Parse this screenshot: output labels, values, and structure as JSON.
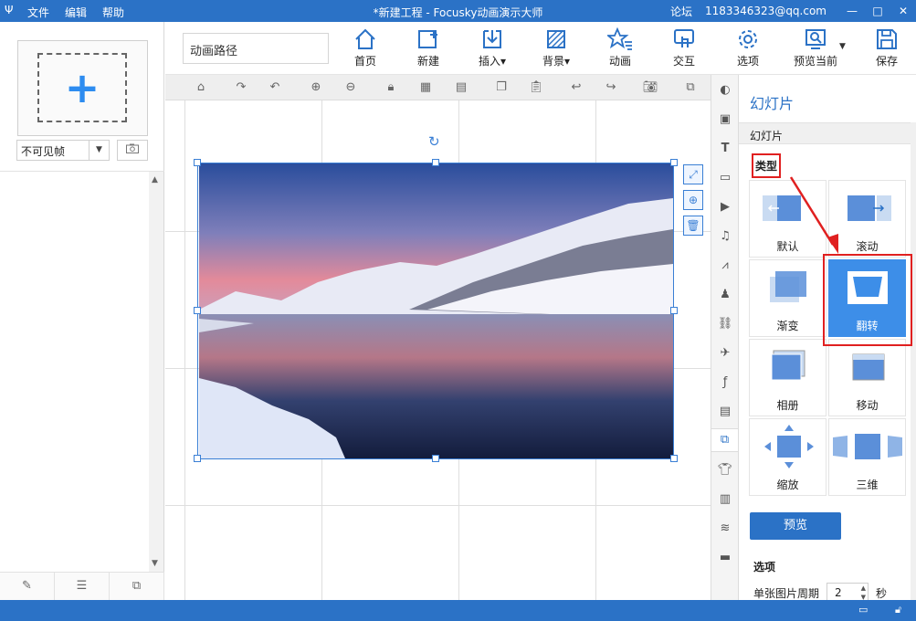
{
  "titlebar": {
    "logo": "Ψ",
    "menu": [
      "文件",
      "编辑",
      "帮助"
    ],
    "title": "*新建工程 - Focusky动画演示大师",
    "forum": "论坛",
    "account": "1183346323@qq.com",
    "minimize": "—",
    "maximize": "□",
    "close": "✕"
  },
  "left": {
    "add_symbol": "+",
    "frame_select": "不可见帧"
  },
  "toolbar": {
    "path_name": "动画路径",
    "buttons": [
      {
        "label": "首页",
        "icon": "home-icon"
      },
      {
        "label": "新建",
        "icon": "new-slide-icon"
      },
      {
        "label": "插入",
        "icon": "insert-icon"
      },
      {
        "label": "背景",
        "icon": "background-icon"
      },
      {
        "label": "动画",
        "icon": "animation-icon"
      },
      {
        "label": "交互",
        "icon": "interaction-icon"
      },
      {
        "label": "选项",
        "icon": "gear-icon"
      },
      {
        "label": "预览当前",
        "icon": "preview-icon"
      },
      {
        "label": "保存",
        "icon": "save-icon"
      }
    ]
  },
  "right": {
    "title": "幻灯片",
    "section": "幻灯片",
    "type_label": "类型",
    "types": [
      {
        "label": "默认"
      },
      {
        "label": "滚动"
      },
      {
        "label": "渐变"
      },
      {
        "label": "翻转",
        "selected": true
      },
      {
        "label": "相册"
      },
      {
        "label": "移动"
      },
      {
        "label": "缩放"
      },
      {
        "label": "三维"
      }
    ],
    "preview_button": "预览",
    "options_title": "选项",
    "period_label": "单张图片周期",
    "period_value": "2",
    "period_unit": "秒"
  },
  "colors": {
    "brand": "#2b72c6",
    "selected": "#3d8ee8",
    "annotation": "#e02020"
  }
}
